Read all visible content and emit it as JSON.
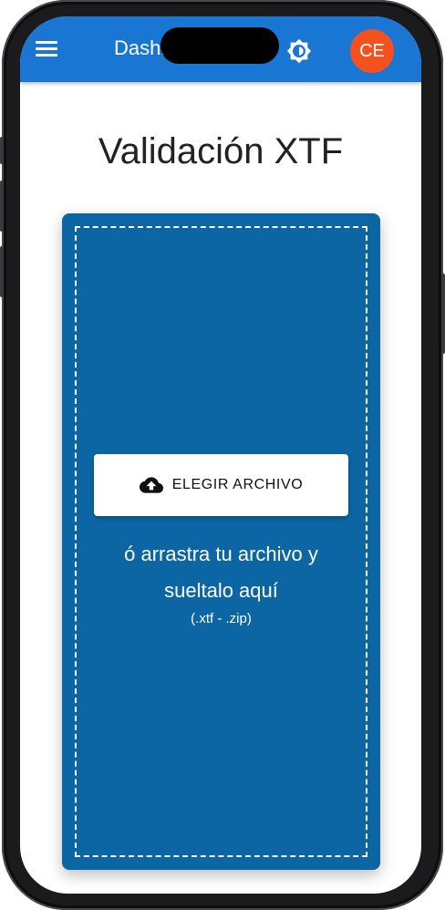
{
  "appbar": {
    "title": "Dashboard",
    "avatar_initials": "CE",
    "color": "#1976d2",
    "avatar_color": "#f4511e",
    "icons": [
      "menu-icon",
      "brightness-icon"
    ]
  },
  "page": {
    "title": "Validación XTF"
  },
  "dropzone": {
    "color": "#0b66a3",
    "button_label": "ELEGIR ARCHIVO",
    "button_icon": "cloud-upload-icon",
    "text_line1": "ó arrastra tu archivo y",
    "text_line2": "sueltalo aquí",
    "hint": "(.xtf - .zip)"
  }
}
